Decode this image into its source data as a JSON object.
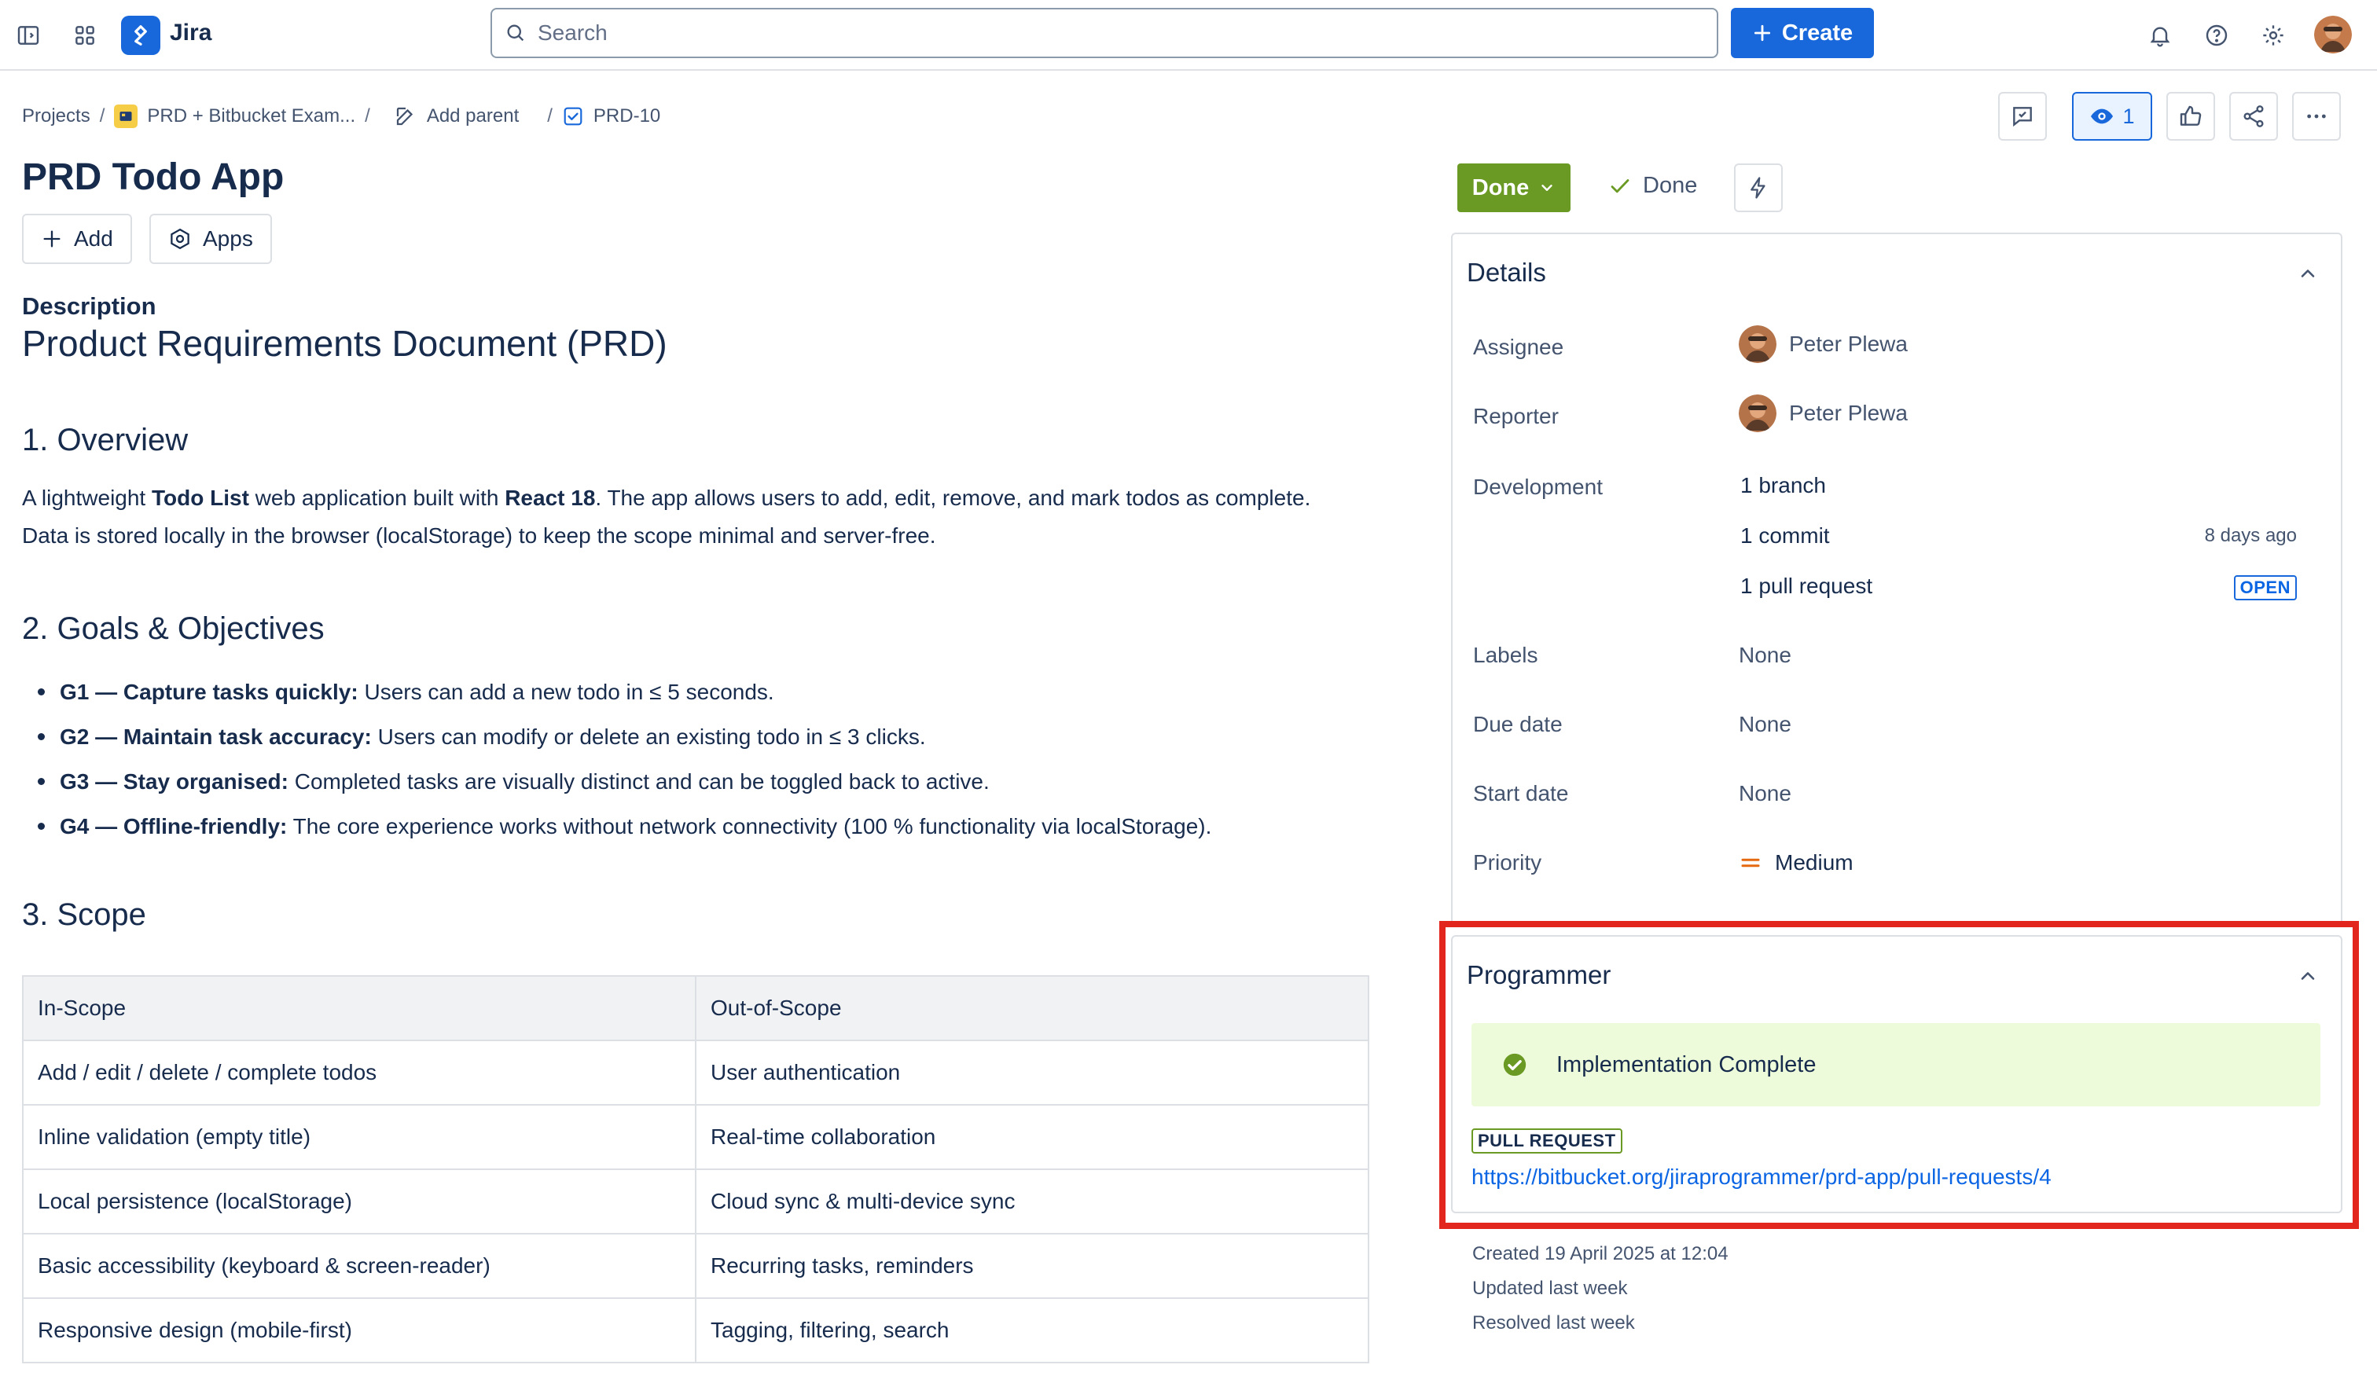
{
  "topbar": {
    "app_name": "Jira",
    "search_placeholder": "Search",
    "create_label": "Create"
  },
  "breadcrumb": {
    "projects": "Projects",
    "project_name": "PRD + Bitbucket Exam...",
    "add_parent": "Add parent",
    "issue_key": "PRD-10"
  },
  "actions": {
    "watch_count": "1"
  },
  "issue": {
    "title": "PRD Todo App",
    "add_label": "Add",
    "apps_label": "Apps"
  },
  "description": {
    "label": "Description",
    "heading": "Product Requirements Document (PRD)",
    "overview_heading": "1. Overview",
    "overview": {
      "p1": "A lightweight ",
      "b1": "Todo List",
      "p2": " web application built with ",
      "b2": "React 18",
      "p3": ". The app allows users to add, edit, remove, and mark todos as complete. Data is stored locally in the browser (localStorage) to keep the scope minimal and server-free."
    },
    "goals_heading": "2. Goals & Objectives",
    "goals": [
      {
        "bold": "G1 — Capture tasks quickly:",
        "text": " Users can add a new todo in ≤ 5 seconds."
      },
      {
        "bold": "G2 — Maintain task accuracy:",
        "text": " Users can modify or delete an existing todo in ≤ 3 clicks."
      },
      {
        "bold": "G3 — Stay organised:",
        "text": " Completed tasks are visually distinct and can be toggled back to active."
      },
      {
        "bold": "G4 — Offline-friendly:",
        "text": " The core experience works without network connectivity (100 % functionality via localStorage)."
      }
    ],
    "scope_heading": "3. Scope",
    "scope_table": {
      "headers": [
        "In-Scope",
        "Out-of-Scope"
      ],
      "rows": [
        [
          "Add / edit / delete / complete todos",
          "User authentication"
        ],
        [
          "Inline validation (empty title)",
          "Real-time collaboration"
        ],
        [
          "Local persistence (localStorage)",
          "Cloud sync & multi-device sync"
        ],
        [
          "Basic accessibility (keyboard & screen-reader)",
          "Recurring tasks, reminders"
        ],
        [
          "Responsive design (mobile-first)",
          "Tagging, filtering, search"
        ]
      ]
    }
  },
  "status": {
    "button_label": "Done",
    "resolution": "Done"
  },
  "details": {
    "title": "Details",
    "assignee_label": "Assignee",
    "assignee": "Peter Plewa",
    "reporter_label": "Reporter",
    "reporter": "Peter Plewa",
    "development_label": "Development",
    "branch": "1 branch",
    "commit": "1 commit",
    "commit_ago": "8 days ago",
    "pull_request": "1 pull request",
    "pr_status": "OPEN",
    "labels_label": "Labels",
    "labels": "None",
    "due_label": "Due date",
    "due": "None",
    "start_label": "Start date",
    "start": "None",
    "priority_label": "Priority",
    "priority": "Medium"
  },
  "programmer": {
    "title": "Programmer",
    "status": "Implementation Complete",
    "pr_tag": "PULL REQUEST",
    "pr_url": "https://bitbucket.org/jiraprogrammer/prd-app/pull-requests/4"
  },
  "meta": {
    "created": "Created 19 April 2025 at 12:04",
    "updated": "Updated last week",
    "resolved": "Resolved last week"
  },
  "colors": {
    "brand_blue": "#1868db",
    "done_green": "#6a9a23",
    "highlight_red": "#e3261d",
    "success_bg": "#eefbda",
    "priority_orange": "#e56910"
  }
}
